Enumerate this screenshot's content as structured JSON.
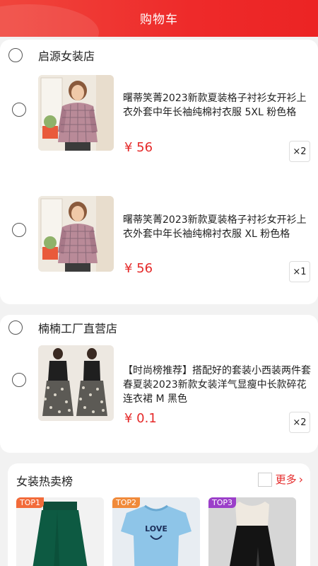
{
  "header": {
    "title": "购物车"
  },
  "stores": [
    {
      "name": "启源女装店",
      "items": [
        {
          "title": "曙蒂笑菁2023新款夏装格子衬衫女开衫上衣外套中年长袖纯棉衬衣服 5XL 粉色格",
          "price": "¥ 56",
          "qty": "×2"
        },
        {
          "title": "曙蒂笑菁2023新款夏装格子衬衫女开衫上衣外套中年长袖纯棉衬衣服 XL 粉色格",
          "price": "¥ 56",
          "qty": "×1"
        }
      ]
    },
    {
      "name": "楠楠工厂直营店",
      "items": [
        {
          "title": "【时尚榜推荐】搭配好的套装小西装两件套春夏装2023新款女装洋气显瘦中长款碎花连衣裙 M 黑色",
          "price": "¥ 0.1",
          "qty": "×2"
        }
      ]
    }
  ],
  "hot": {
    "title": "女装热卖榜",
    "more": "更多",
    "items": [
      {
        "badge": "TOP1",
        "badge_color": "#f26b3a"
      },
      {
        "badge": "TOP2",
        "badge_color": "#f08a3a"
      },
      {
        "badge": "TOP3",
        "badge_color": "#9b3fc9"
      }
    ],
    "shirt_print": "LOVE"
  },
  "colors": {
    "accent": "#e52a2a",
    "header": "#ee2a2a"
  }
}
